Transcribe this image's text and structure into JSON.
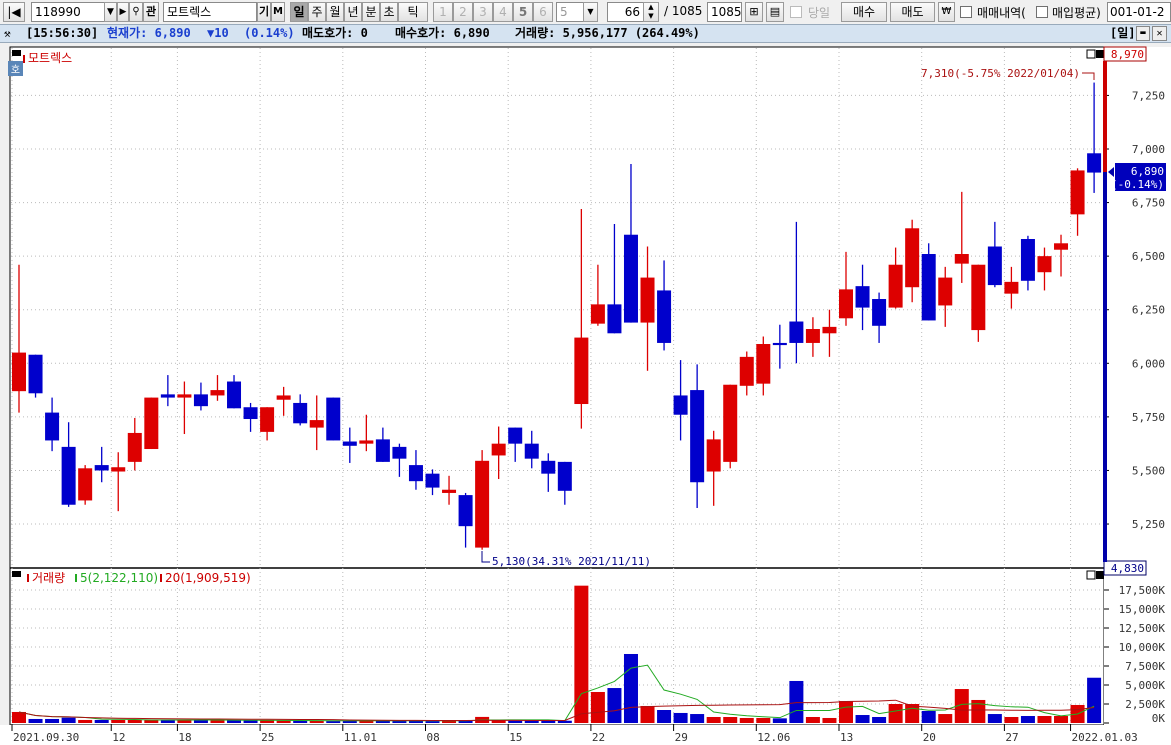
{
  "toolbar": {
    "code": "118990",
    "name": "모트렉스",
    "gwan": "관",
    "gi": "기",
    "m": "M",
    "periods": [
      "일",
      "주",
      "월",
      "년",
      "분",
      "초",
      "틱"
    ],
    "selected_period": "일",
    "numbers": [
      "1",
      "2",
      "3",
      "4",
      "5",
      "6"
    ],
    "number_select": "5",
    "count": "66",
    "total": "/ 1085",
    "total_field": "1085",
    "today_label": "당일",
    "buy": "매수",
    "sell": "매도",
    "won": "₩",
    "trade_history": "매매내역(",
    "avg_buy": "매입평균)",
    "account": "001-01-2"
  },
  "info": {
    "time": "[15:56:30]",
    "current": "현재가: 6,890",
    "change": "▼10",
    "pct": "(0.14%)",
    "ask": "매도호가: 0",
    "bid": "매수호가: 6,890",
    "volume": "거래량: 5,956,177 (264.49%)",
    "period": "[일]"
  },
  "colors": {
    "up": "#dd0000",
    "down": "#0000cc",
    "ma5": "#22aa22",
    "ma20": "#aa1111"
  },
  "chart_data": [
    {
      "type": "candlestick",
      "title": "모트렉스",
      "side_button": "호",
      "yticks": [
        5250,
        5500,
        5750,
        6000,
        6250,
        6500,
        6750,
        7000,
        7250
      ],
      "ytick_labels": [
        "5,250",
        "5,500",
        "5,750",
        "6,000",
        "6,250",
        "6,500",
        "6,750",
        "7,000",
        "7,250"
      ],
      "upper_limit": "8,970",
      "lower_limit": "4,830",
      "current_label": "6,890",
      "current_pct": "(-0.14%)",
      "current": 6890,
      "max_annotation": {
        "text": "7,310(-5.75% 2022/01/04)",
        "index": 65,
        "value": 7310
      },
      "min_annotation": {
        "text": "5,130(34.31% 2021/11/11)",
        "index": 28,
        "value": 5130
      },
      "ohlc": [
        [
          5870,
          6460,
          5770,
          6050
        ],
        [
          6040,
          6040,
          5840,
          5860
        ],
        [
          5770,
          5840,
          5590,
          5640
        ],
        [
          5610,
          5725,
          5330,
          5340
        ],
        [
          5360,
          5525,
          5340,
          5510
        ],
        [
          5525,
          5610,
          5445,
          5500
        ],
        [
          5495,
          5585,
          5310,
          5515
        ],
        [
          5540,
          5745,
          5500,
          5675
        ],
        [
          5600,
          5840,
          5600,
          5840
        ],
        [
          5855,
          5945,
          5800,
          5840
        ],
        [
          5840,
          5915,
          5670,
          5855
        ],
        [
          5855,
          5910,
          5780,
          5800
        ],
        [
          5850,
          5945,
          5825,
          5875
        ],
        [
          5915,
          5945,
          5790,
          5790
        ],
        [
          5795,
          5815,
          5680,
          5740
        ],
        [
          5680,
          5795,
          5640,
          5795
        ],
        [
          5830,
          5890,
          5755,
          5850
        ],
        [
          5815,
          5855,
          5710,
          5720
        ],
        [
          5700,
          5850,
          5595,
          5735
        ],
        [
          5840,
          5840,
          5640,
          5640
        ],
        [
          5635,
          5700,
          5535,
          5615
        ],
        [
          5625,
          5760,
          5590,
          5640
        ],
        [
          5645,
          5700,
          5540,
          5540
        ],
        [
          5610,
          5625,
          5470,
          5555
        ],
        [
          5525,
          5595,
          5410,
          5450
        ],
        [
          5485,
          5505,
          5385,
          5420
        ],
        [
          5395,
          5475,
          5340,
          5410
        ],
        [
          5385,
          5395,
          5140,
          5240
        ],
        [
          5140,
          5595,
          5130,
          5545
        ],
        [
          5570,
          5705,
          5460,
          5625
        ],
        [
          5700,
          5700,
          5540,
          5625
        ],
        [
          5625,
          5685,
          5510,
          5555
        ],
        [
          5545,
          5580,
          5400,
          5485
        ],
        [
          5540,
          5540,
          5340,
          5405
        ],
        [
          5810,
          6720,
          5695,
          6120
        ],
        [
          6185,
          6460,
          6175,
          6275
        ],
        [
          6275,
          6650,
          6140,
          6140
        ],
        [
          6600,
          6930,
          6190,
          6190
        ],
        [
          6190,
          6545,
          5965,
          6400
        ],
        [
          6340,
          6480,
          6060,
          6095
        ],
        [
          5850,
          6015,
          5640,
          5760
        ],
        [
          5875,
          5995,
          5325,
          5445
        ],
        [
          5495,
          5685,
          5335,
          5645
        ],
        [
          5540,
          5900,
          5510,
          5900
        ],
        [
          5895,
          6055,
          5850,
          6030
        ],
        [
          5905,
          6125,
          5850,
          6090
        ],
        [
          6095,
          6180,
          5975,
          6085
        ],
        [
          6195,
          6660,
          6000,
          6095
        ],
        [
          6095,
          6215,
          6030,
          6160
        ],
        [
          6140,
          6250,
          6030,
          6170
        ],
        [
          6210,
          6520,
          6175,
          6345
        ],
        [
          6360,
          6460,
          6155,
          6260
        ],
        [
          6300,
          6330,
          6095,
          6175
        ],
        [
          6260,
          6540,
          6255,
          6460
        ],
        [
          6355,
          6670,
          6285,
          6630
        ],
        [
          6510,
          6560,
          6200,
          6200
        ],
        [
          6270,
          6450,
          6170,
          6400
        ],
        [
          6465,
          6800,
          6375,
          6510
        ],
        [
          6155,
          6460,
          6100,
          6460
        ],
        [
          6545,
          6660,
          6355,
          6365
        ],
        [
          6325,
          6450,
          6255,
          6380
        ],
        [
          6580,
          6595,
          6340,
          6385
        ],
        [
          6425,
          6540,
          6340,
          6500
        ],
        [
          6530,
          6600,
          6405,
          6560
        ],
        [
          6695,
          6910,
          6595,
          6900
        ],
        [
          6980,
          7310,
          6795,
          6890
        ]
      ]
    },
    {
      "type": "bar",
      "title": "거래량",
      "ma5_label": "5(2,122,110)",
      "ma20_label": "20(1,909,519)",
      "unit": "K",
      "yticks": [
        0,
        2500,
        5000,
        7500,
        10000,
        12500,
        15000,
        17500
      ],
      "ytick_labels": [
        "0K",
        "2,500K",
        "5,000K",
        "7,500K",
        "10,000K",
        "12,500K",
        "15,000K",
        "17,500K"
      ],
      "values": [
        1450,
        530,
        530,
        700,
        400,
        400,
        400,
        400,
        400,
        400,
        400,
        400,
        350,
        350,
        350,
        350,
        300,
        300,
        300,
        250,
        300,
        300,
        300,
        300,
        300,
        250,
        300,
        300,
        800,
        350,
        300,
        300,
        300,
        300,
        18070,
        4080,
        4600,
        9080,
        2240,
        1710,
        1320,
        1180,
        790,
        790,
        660,
        660,
        610,
        5530,
        790,
        660,
        2890,
        1050,
        790,
        2500,
        2500,
        1580,
        1180,
        4470,
        3030,
        1180,
        790,
        920,
        920,
        920,
        2370,
        5956
      ]
    }
  ],
  "xaxis": {
    "labels": [
      "2021.09.30",
      "12",
      "18",
      "25",
      "11.01",
      "08",
      "15",
      "22",
      "29",
      "12.06",
      "13",
      "20",
      "27",
      "2022.01.03"
    ],
    "indices": [
      0,
      6,
      10,
      15,
      20,
      25,
      30,
      35,
      40,
      45,
      50,
      55,
      60,
      64
    ]
  }
}
